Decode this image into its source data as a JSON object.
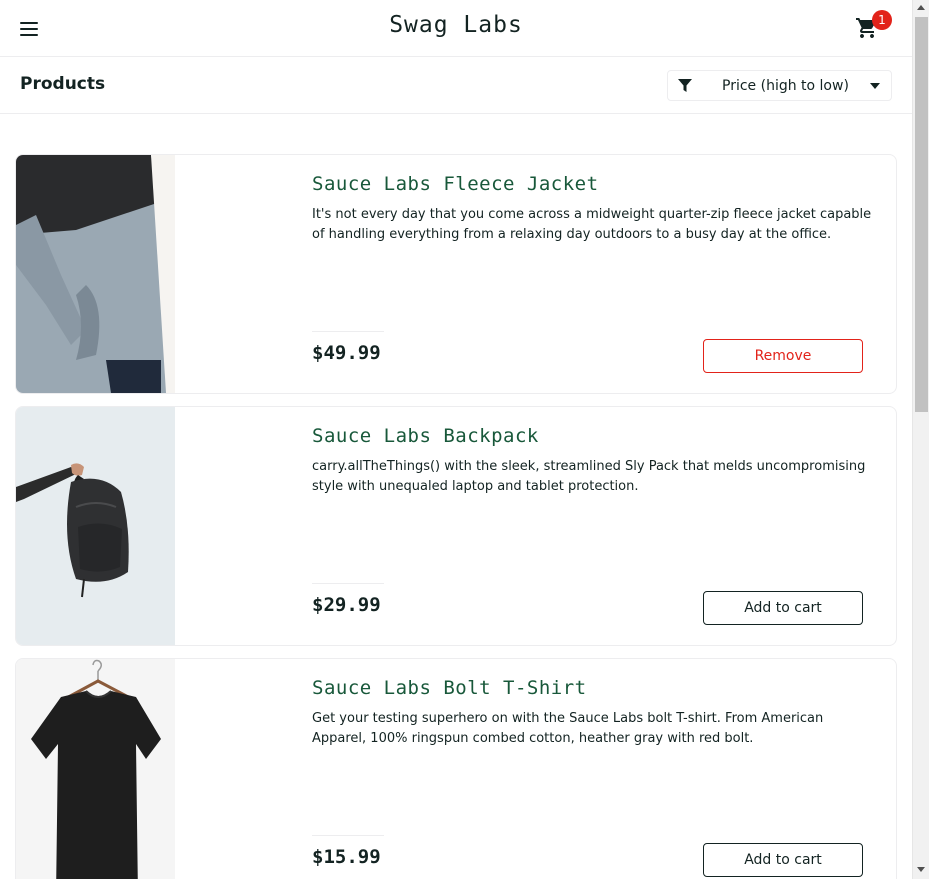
{
  "header": {
    "logo": "Swag Labs",
    "cart_count": "1",
    "menu_icon": "hamburger-menu-icon",
    "cart_icon": "shopping-cart-icon"
  },
  "subheader": {
    "title": "Products",
    "sort_selected": "Price (high to low)",
    "filter_icon": "filter-funnel-icon"
  },
  "colors": {
    "accent_green": "#18583a",
    "remove_red": "#e2231a",
    "badge_red": "#e2231a",
    "text_dark": "#132322"
  },
  "items": [
    {
      "name": "Sauce Labs Fleece Jacket",
      "description": "It's not every day that you come across a midweight quarter-zip fleece jacket capable of handling everything from a relaxing day outdoors to a busy day at the office.",
      "price": "$49.99",
      "button": "Remove"
    },
    {
      "name": "Sauce Labs Backpack",
      "description": "carry.allTheThings() with the sleek, streamlined Sly Pack that melds uncompromising style with unequaled laptop and tablet protection.",
      "price": "$29.99",
      "button": "Add to cart"
    },
    {
      "name": "Sauce Labs Bolt T-Shirt",
      "description": "Get your testing superhero on with the Sauce Labs bolt T-shirt. From American Apparel, 100% ringspun combed cotton, heather gray with red bolt.",
      "price": "$15.99",
      "button": "Add to cart"
    }
  ]
}
